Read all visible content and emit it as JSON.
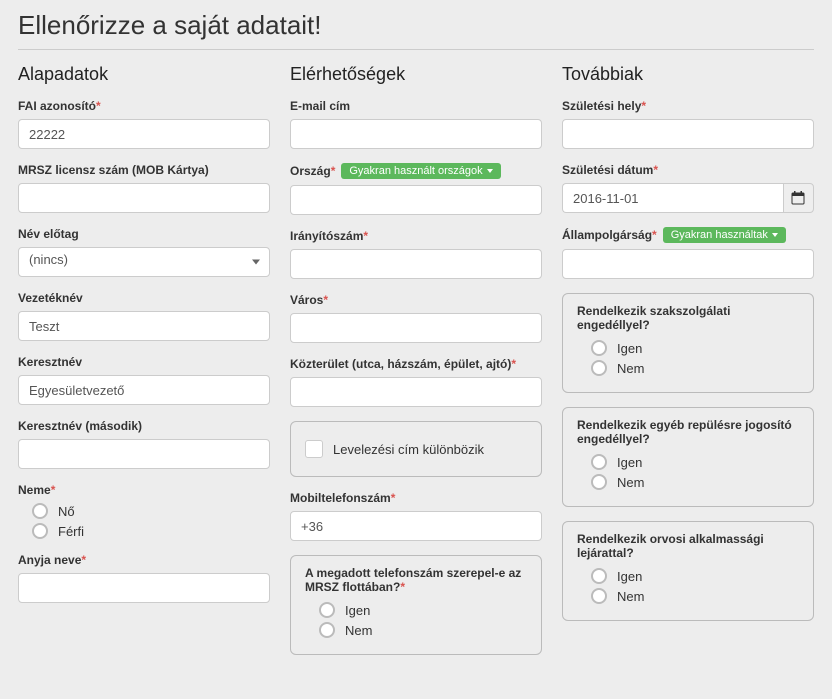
{
  "heading": "Ellenőrizze a saját adatait!",
  "columns": {
    "basics": {
      "title": "Alapadatok",
      "fai": {
        "label": "FAI azonosító",
        "value": "22222"
      },
      "mrsz": {
        "label": "MRSZ licensz szám (MOB Kártya)",
        "value": ""
      },
      "prefix": {
        "label": "Név előtag",
        "selected": "(nincs)"
      },
      "lastname": {
        "label": "Vezetéknév",
        "value": "Teszt"
      },
      "firstname": {
        "label": "Keresztnév",
        "value": "Egyesületvezető"
      },
      "firstname2": {
        "label": "Keresztnév (második)",
        "value": ""
      },
      "gender": {
        "label": "Neme",
        "options": {
          "female": "Nő",
          "male": "Férfi"
        }
      },
      "mothername": {
        "label": "Anyja neve",
        "value": ""
      }
    },
    "contact": {
      "title": "Elérhetőségek",
      "email": {
        "label": "E-mail cím",
        "value": ""
      },
      "country": {
        "label": "Ország",
        "badge": "Gyakran használt országok",
        "value": ""
      },
      "zip": {
        "label": "Irányítószám",
        "value": ""
      },
      "city": {
        "label": "Város",
        "value": ""
      },
      "street": {
        "label": "Közterület (utca, házszám, épület, ajtó)",
        "value": ""
      },
      "mailing_differs": {
        "label": "Levelezési cím különbözik"
      },
      "mobile": {
        "label": "Mobiltelefonszám",
        "value": "+36"
      },
      "fleet": {
        "question": "A megadott telefonszám szerepel-e az MRSZ flottában?",
        "yes": "Igen",
        "no": "Nem"
      }
    },
    "more": {
      "title": "Továbbiak",
      "birthplace": {
        "label": "Születési hely",
        "value": ""
      },
      "birthdate": {
        "label": "Születési dátum",
        "value": "2016-11-01"
      },
      "citizenship": {
        "label": "Állampolgárság",
        "badge": "Gyakran használtak",
        "value": ""
      },
      "service_permit": {
        "question": "Rendelkezik szakszolgálati engedéllyel?",
        "yes": "Igen",
        "no": "Nem"
      },
      "other_permit": {
        "question": "Rendelkezik egyéb repülésre jogosító engedéllyel?",
        "yes": "Igen",
        "no": "Nem"
      },
      "medical": {
        "question": "Rendelkezik orvosi alkalmassági lejárattal?",
        "yes": "Igen",
        "no": "Nem"
      }
    }
  }
}
